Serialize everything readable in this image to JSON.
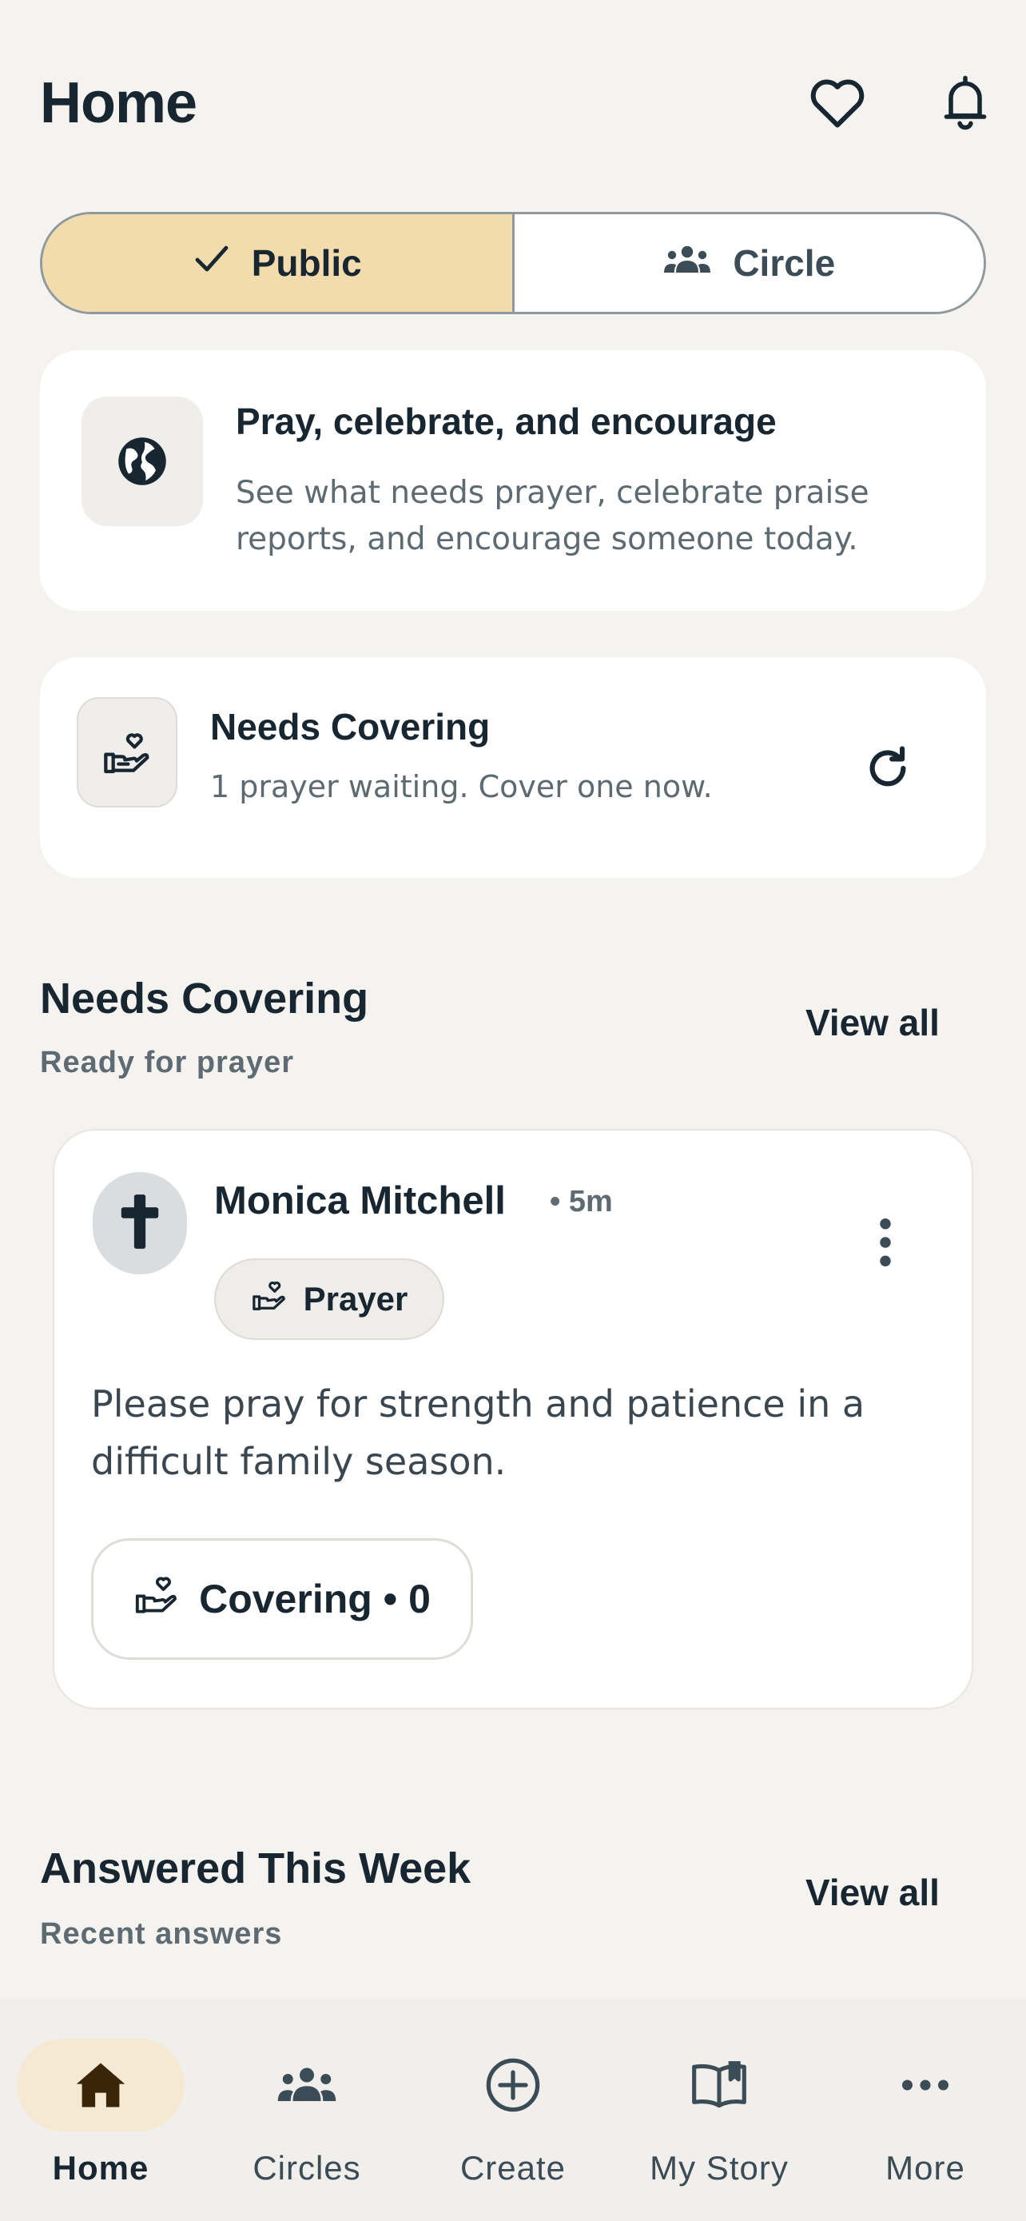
{
  "header": {
    "title": "Home",
    "icons": [
      "heart-icon",
      "bell-icon"
    ]
  },
  "segment": {
    "public_label": "Public",
    "circle_label": "Circle",
    "selected": "Public"
  },
  "intro_card": {
    "title": "Pray, celebrate, and encourage",
    "description": "See what needs prayer, celebrate praise reports, and encourage someone today.",
    "icon": "globe-icon"
  },
  "needs_card": {
    "title": "Needs Covering",
    "subtitle": "1 prayer waiting. Cover one now.",
    "icon": "praying-hand-heart-icon"
  },
  "needs_section": {
    "title": "Needs Covering",
    "subtitle": "Ready for prayer",
    "view_all": "View all"
  },
  "post": {
    "author": "Monica Mitchell",
    "time": "• 5m",
    "tag": "Prayer",
    "body": "Please pray for strength and patience in a difficult family season.",
    "covering_label": "Covering • 0",
    "covering_count": 0
  },
  "answered_section": {
    "title": "Answered This Week",
    "subtitle": "Recent answers",
    "view_all": "View all"
  },
  "bottom_nav": {
    "items": [
      {
        "label": "Home",
        "icon": "home-icon",
        "active": true
      },
      {
        "label": "Circles",
        "icon": "people-icon",
        "active": false
      },
      {
        "label": "Create",
        "icon": "plus-circle-icon",
        "active": false
      },
      {
        "label": "My Story",
        "icon": "book-icon",
        "active": false
      },
      {
        "label": "More",
        "icon": "more-icon",
        "active": false
      }
    ]
  },
  "colors": {
    "background": "#f4f3ef",
    "accent": "#f2dcad",
    "text": "#172630",
    "muted": "#5d6a72",
    "card": "#ffffff"
  }
}
